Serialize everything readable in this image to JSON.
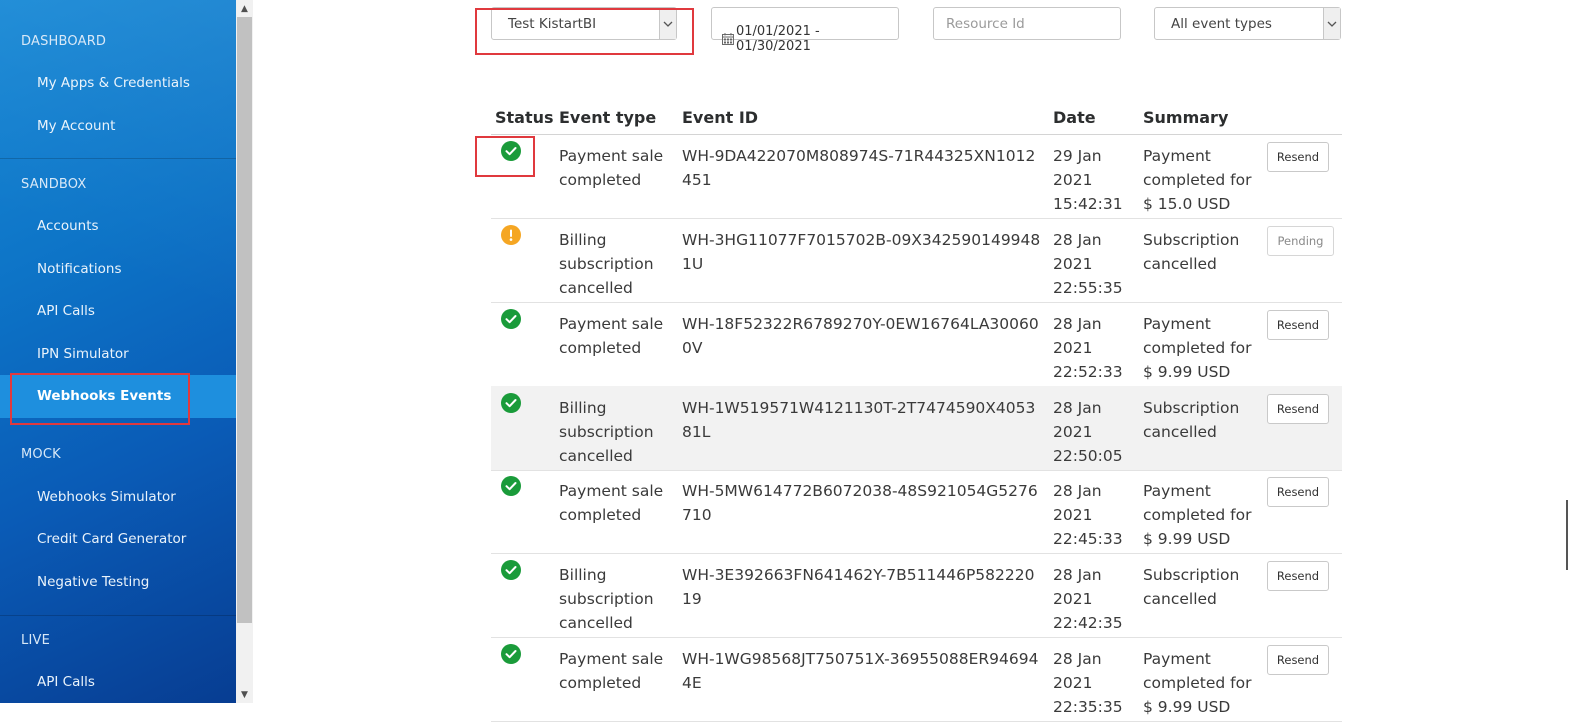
{
  "sidebar": {
    "sections": [
      {
        "heading": "DASHBOARD",
        "items": [
          "My Apps & Credentials",
          "My Account"
        ]
      },
      {
        "heading": "SANDBOX",
        "items": [
          "Accounts",
          "Notifications",
          "API Calls",
          "IPN Simulator",
          "Webhooks Events"
        ]
      },
      {
        "heading": "MOCK",
        "items": [
          "Webhooks Simulator",
          "Credit Card Generator",
          "Negative Testing"
        ]
      },
      {
        "heading": "LIVE",
        "items": [
          "API Calls"
        ]
      }
    ],
    "active_item": "Webhooks Events"
  },
  "filters": {
    "account": "Test KistartBI",
    "date_range": "01/01/2021 - 01/30/2021",
    "resource_placeholder": "Resource Id",
    "event_type": "All event types"
  },
  "table": {
    "headers": {
      "status": "Status",
      "event_type": "Event type",
      "event_id": "Event ID",
      "date": "Date",
      "summary": "Summary"
    },
    "rows": [
      {
        "status": "success",
        "event_type": "Payment sale completed",
        "event_id": "WH-9DA422070M808974S-71R44325XN1012451",
        "date": "29 Jan 2021 15:42:31",
        "summary": "Payment completed for $ 15.0 USD",
        "action": "Resend"
      },
      {
        "status": "warning",
        "event_type": "Billing subscription cancelled",
        "event_id": "WH-3HG11077F7015702B-09X3425901499481U",
        "date": "28 Jan 2021 22:55:35",
        "summary": "Subscription cancelled",
        "action": "Pending"
      },
      {
        "status": "success",
        "event_type": "Payment sale completed",
        "event_id": "WH-18F52322R6789270Y-0EW16764LA300600V",
        "date": "28 Jan 2021 22:52:33",
        "summary": "Payment completed for $ 9.99 USD",
        "action": "Resend"
      },
      {
        "status": "success",
        "event_type": "Billing subscription cancelled",
        "event_id": "WH-1W519571W4121130T-2T7474590X405381L",
        "date": "28 Jan 2021 22:50:05",
        "summary": "Subscription cancelled",
        "action": "Resend"
      },
      {
        "status": "success",
        "event_type": "Payment sale completed",
        "event_id": "WH-5MW614772B6072038-48S921054G5276710",
        "date": "28 Jan 2021 22:45:33",
        "summary": "Payment completed for $ 9.99 USD",
        "action": "Resend"
      },
      {
        "status": "success",
        "event_type": "Billing subscription cancelled",
        "event_id": "WH-3E392663FN641462Y-7B511446P58222019",
        "date": "28 Jan 2021 22:42:35",
        "summary": "Subscription cancelled",
        "action": "Resend"
      },
      {
        "status": "success",
        "event_type": "Payment sale completed",
        "event_id": "WH-1WG98568JT750751X-36955088ER946944E",
        "date": "28 Jan 2021 22:35:35",
        "summary": "Payment completed for $ 9.99 USD",
        "action": "Resend"
      }
    ]
  },
  "colors": {
    "success": "#1a9b3a",
    "warning": "#f5a623",
    "highlight": "#e0393e"
  }
}
